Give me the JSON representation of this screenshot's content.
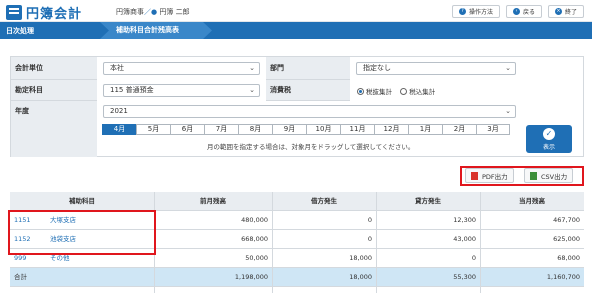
{
  "app": {
    "title": "円簿会計"
  },
  "header": {
    "company": "円簿商事",
    "separator": "／●",
    "user": "円簿 二郎",
    "buttons": [
      {
        "label": "操作方法",
        "icon": "question-icon"
      },
      {
        "label": "戻る",
        "icon": "back-arrow-icon"
      },
      {
        "label": "終了",
        "icon": "close-icon"
      }
    ]
  },
  "nav": {
    "section": "日次処理",
    "page": "補助科目合計残高表"
  },
  "form": {
    "unit_label": "会計単位",
    "unit_value": "本社",
    "dept_label": "部門",
    "dept_value": "指定なし",
    "account_label": "勘定科目",
    "account_value": "115 普通預金",
    "tax_label": "消費税",
    "tax_options": [
      "税抜集計",
      "税込集計"
    ],
    "tax_selected": "税抜集計",
    "year_label": "年度",
    "year_value": "2021",
    "months": [
      "4月",
      "5月",
      "6月",
      "7月",
      "8月",
      "9月",
      "10月",
      "11月",
      "12月",
      "1月",
      "2月",
      "3月"
    ],
    "selected_month": "4月",
    "hint": "月の範囲を指定する場合は、対象月をドラッグして選択してください。",
    "show_button": "表示"
  },
  "export": {
    "pdf_label": "PDF出力",
    "csv_label": "CSV出力"
  },
  "table": {
    "headers": [
      "補助科目",
      "前月残高",
      "借方発生",
      "貸方発生",
      "当月残高"
    ],
    "rows": [
      {
        "code": "1151",
        "name": "大塚支店",
        "prev": "480,000",
        "debit": "0",
        "credit": "12,300",
        "balance": "467,700"
      },
      {
        "code": "1152",
        "name": "池袋支店",
        "prev": "668,000",
        "debit": "0",
        "credit": "43,000",
        "balance": "625,000"
      },
      {
        "code": "999",
        "name": "その他",
        "prev": "50,000",
        "debit": "18,000",
        "credit": "0",
        "balance": "68,000"
      }
    ],
    "total": {
      "label": "合計",
      "prev": "1,198,000",
      "debit": "18,000",
      "credit": "55,300",
      "balance": "1,160,700"
    }
  },
  "colors": {
    "accent": "#1f6fb5",
    "highlight": "#e0161d",
    "total_row": "#cfe6f5"
  }
}
